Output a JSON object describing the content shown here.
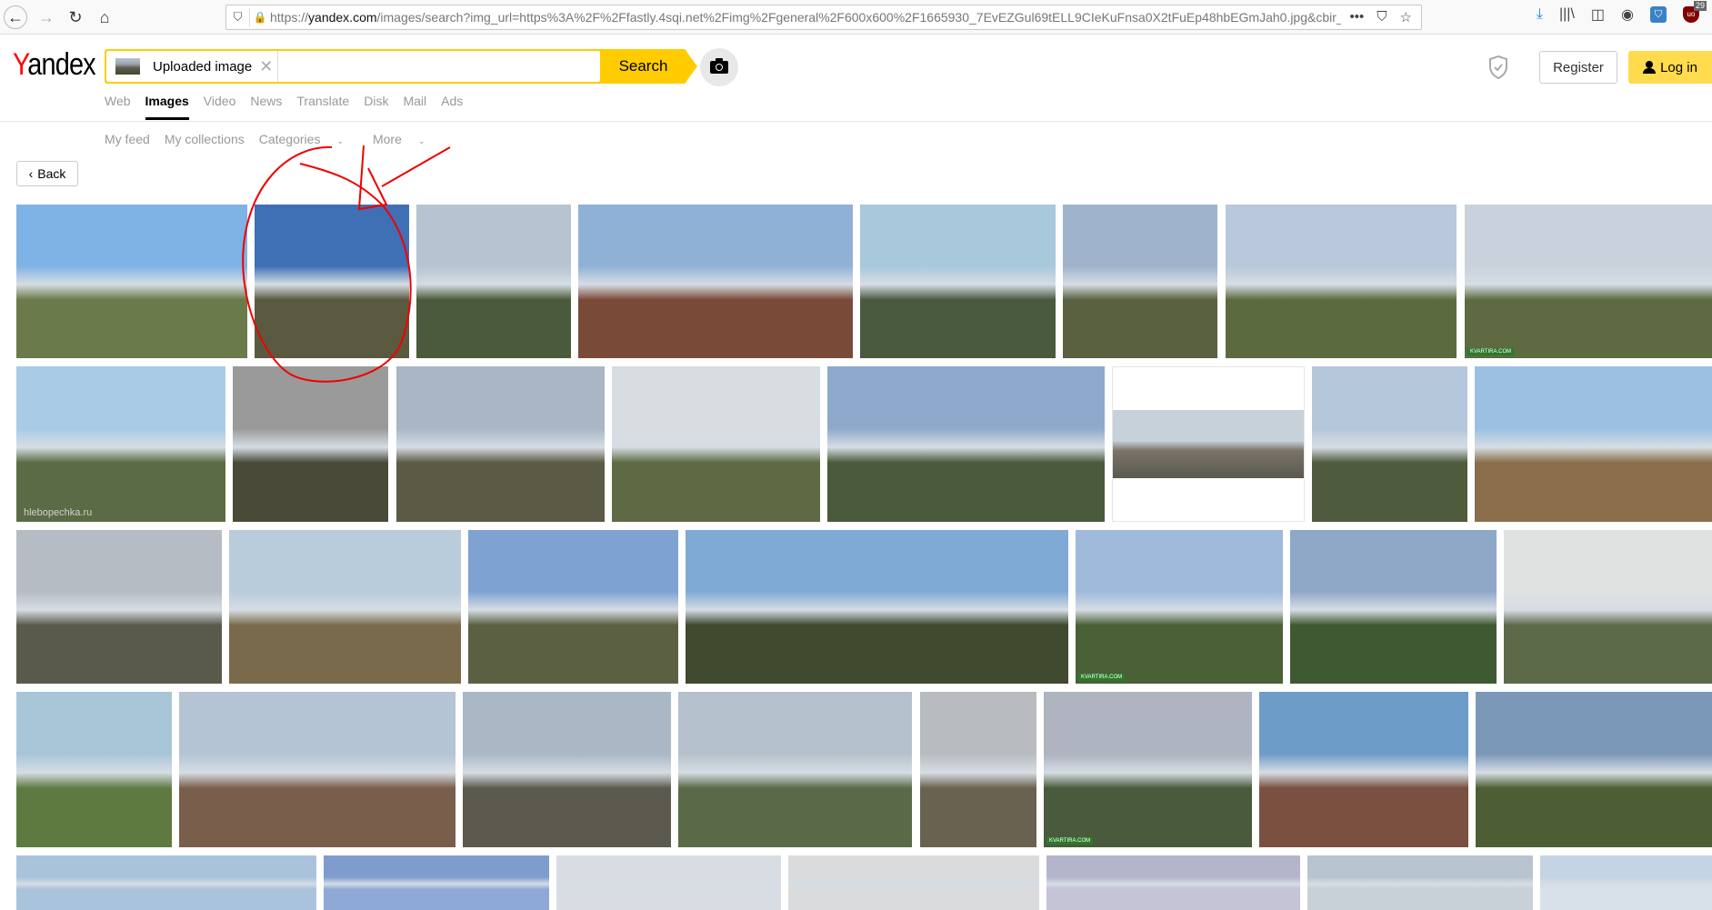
{
  "browser": {
    "url_prefix": "https://",
    "url_domain": "yandex.com",
    "url_rest": "/images/search?img_url=https%3A%2F%2Ffastly.4sqi.net%2Fimg%2Fgeneral%2F600x600%2F1665930_7EvEZGul69tELL9CIeKuFnsa0X2tFuEp48hbEGmJah0.jpg&cbir_ic",
    "ublock_count": "29"
  },
  "header": {
    "logo_first": "Y",
    "logo_rest": "andex",
    "search": {
      "chip_label": "Uploaded image",
      "button_label": "Search"
    },
    "register_label": "Register",
    "login_label": "Log in"
  },
  "services": [
    {
      "label": "Web",
      "active": false
    },
    {
      "label": "Images",
      "active": true
    },
    {
      "label": "Video",
      "active": false
    },
    {
      "label": "News",
      "active": false
    },
    {
      "label": "Translate",
      "active": false
    },
    {
      "label": "Disk",
      "active": false
    },
    {
      "label": "Mail",
      "active": false
    },
    {
      "label": "Ads",
      "active": false
    }
  ],
  "subnav": {
    "my_feed": "My feed",
    "my_collections": "My collections",
    "categories": "Categories",
    "more": "More"
  },
  "back_label": "Back",
  "results": {
    "rows": [
      [
        {
          "sky": "#7fb2e5",
          "city": "#6a7a4a",
          "note": ""
        },
        {
          "sky": "#3f6fb5",
          "city": "#5a5a40",
          "note": "",
          "highlighted": true
        },
        {
          "sky": "#b6c3d0",
          "city": "#4b5a3a",
          "note": ""
        },
        {
          "sky": "#8fb1d6",
          "city": "#7a4a38",
          "note": ""
        },
        {
          "sky": "#a8c8dc",
          "city": "#4a5a3e",
          "note": ""
        },
        {
          "sky": "#9fb3cc",
          "city": "#5a6140",
          "note": ""
        },
        {
          "sky": "#b9c8da",
          "city": "#5c6a3f",
          "note": ""
        },
        {
          "sky": "#c9d2dc",
          "city": "#5d6a42",
          "note": "",
          "badge": "kvartiry"
        }
      ],
      [
        {
          "sky": "#a9cbe6",
          "city": "#5b6b45",
          "note": "hlebopechka.ru"
        },
        {
          "sky": "#9a9a9a",
          "city": "#4a4a38",
          "note": ""
        },
        {
          "sky": "#a8b6c6",
          "city": "#5b5a44",
          "note": ""
        },
        {
          "sky": "#d8dde2",
          "city": "#5e6a44",
          "note": ""
        },
        {
          "sky": "#8fa9cc",
          "city": "#4a5a3a",
          "note": ""
        },
        {
          "sky": "#c7d1da",
          "city": "#7a7266",
          "note": "",
          "letterbox": true
        },
        {
          "sky": "#b5c7db",
          "city": "#4e5b3d",
          "note": ""
        },
        {
          "sky": "#9cc0e2",
          "city": "#8a6e4a",
          "note": ""
        }
      ],
      [
        {
          "sky": "#b5bcc4",
          "city": "#5a5a4c",
          "note": ""
        },
        {
          "sky": "#b8ccdc",
          "city": "#7a6a4c",
          "note": ""
        },
        {
          "sky": "#7ea3d2",
          "city": "#5b6042",
          "note": ""
        },
        {
          "sky": "#80aad6",
          "city": "#3f4a2e",
          "note": ""
        },
        {
          "sky": "#9fbadb",
          "city": "#4a6036",
          "note": "",
          "badge": "kvartiry"
        },
        {
          "sky": "#90a8c8",
          "city": "#3f5a32",
          "note": ""
        },
        {
          "sky": "#e0e2e2",
          "city": "#5c6a4a",
          "note": ""
        }
      ],
      [
        {
          "sky": "#a8c6d8",
          "city": "#5f7a40",
          "note": ""
        },
        {
          "sky": "#b4c4d4",
          "city": "#7a5e4c",
          "note": ""
        },
        {
          "sky": "#aab8c6",
          "city": "#5c5a4e",
          "note": ""
        },
        {
          "sky": "#b5c1cc",
          "city": "#5a6a48",
          "note": ""
        },
        {
          "sky": "#b8bcc0",
          "city": "#6a6250",
          "note": ""
        },
        {
          "sky": "#aeb4c0",
          "city": "#4a5a3c",
          "note": "",
          "badge": "kvartiry"
        },
        {
          "sky": "#6e9cc8",
          "city": "#7a5040",
          "note": ""
        },
        {
          "sky": "#7c98b8",
          "city": "#4e5e34",
          "note": ""
        }
      ],
      [
        {
          "sky": "#a9c3dc",
          "city": "#a9c3dc",
          "note": ""
        },
        {
          "sky": "#7f9ccf",
          "city": "#8fa9d6",
          "note": ""
        },
        {
          "sky": "#d7dde2",
          "city": "#d7dde2",
          "note": ""
        },
        {
          "sky": "#d9dbdc",
          "city": "#d9dbdc",
          "note": ""
        },
        {
          "sky": "#b4b4cc",
          "city": "#c4c4d6",
          "note": ""
        },
        {
          "sky": "#b8c4d0",
          "city": "#c8d0d8",
          "note": ""
        },
        {
          "sky": "#c5d4e4",
          "city": "#d8e0ea",
          "note": ""
        }
      ]
    ],
    "badge_text": "KVARTIRA.COM"
  }
}
